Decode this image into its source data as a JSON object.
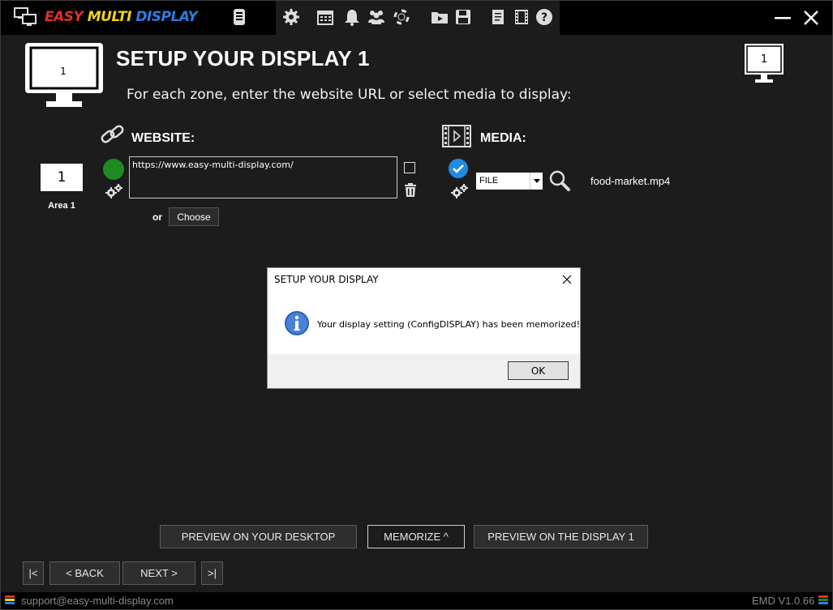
{
  "app": {
    "name_part1": "EASY",
    "name_part2": "MULTI",
    "name_part3": "DISPLAY"
  },
  "toolbar": {
    "icons": [
      "remote-icon",
      "gear-icon",
      "calendar-icon",
      "bell-icon",
      "users-icon",
      "lifebuoy-icon",
      "folder-media-icon",
      "save-icon",
      "notes-icon",
      "film-icon",
      "help-icon"
    ]
  },
  "header": {
    "title": "SETUP YOUR DISPLAY 1",
    "subtitle": "For each zone, enter the website URL or select media to display:",
    "big_monitor_label": "1",
    "small_monitor_label": "1"
  },
  "website": {
    "label": "WEBSITE:",
    "url": "https://www.easy-multi-display.com/",
    "or_label": "or",
    "choose_label": "Choose"
  },
  "area": {
    "number": "1",
    "label": "Area 1"
  },
  "media": {
    "label": "MEDIA:",
    "type": "FILE",
    "filename": "food-market.mp4"
  },
  "actions": {
    "preview_desktop": "PREVIEW ON YOUR DESKTOP",
    "memorize": "MEMORIZE ^",
    "preview_display": "PREVIEW ON THE DISPLAY 1"
  },
  "nav": {
    "first": "|<",
    "back": "< BACK",
    "next": "NEXT >",
    "last": ">|"
  },
  "footer": {
    "email": "support@easy-multi-display.com",
    "version": "EMD V1.0.66"
  },
  "dialog": {
    "title": "SETUP YOUR DISPLAY",
    "message": "Your display setting (ConfigDISPLAY) has been memorized!",
    "ok": "OK"
  },
  "colors": {
    "accent_green": "#1f8a1f",
    "accent_blue": "#1e8de0",
    "brand_red": "#e0312a",
    "brand_yellow": "#f2d21b",
    "brand_blue": "#2c7de0"
  }
}
